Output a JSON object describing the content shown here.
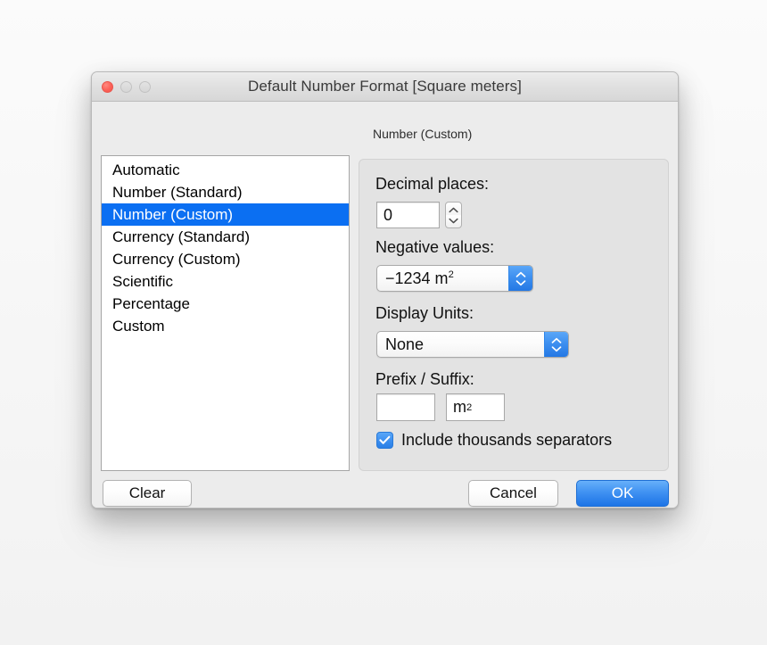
{
  "window": {
    "title": "Default Number Format [Square meters]",
    "traffic_lights": [
      {
        "name": "close",
        "color": "#fc6057"
      },
      {
        "name": "minimize",
        "color": "#d9d9d9"
      },
      {
        "name": "zoom",
        "color": "#d9d9d9"
      }
    ]
  },
  "format_list": {
    "items": [
      {
        "label": "Automatic",
        "selected": false
      },
      {
        "label": "Number (Standard)",
        "selected": false
      },
      {
        "label": "Number (Custom)",
        "selected": true
      },
      {
        "label": "Currency (Standard)",
        "selected": false
      },
      {
        "label": "Currency (Custom)",
        "selected": false
      },
      {
        "label": "Scientific",
        "selected": false
      },
      {
        "label": "Percentage",
        "selected": false
      },
      {
        "label": "Custom",
        "selected": false
      }
    ],
    "selection_color": "#0b6ff2"
  },
  "panel": {
    "caption": "Number (Custom)",
    "decimal_places": {
      "label": "Decimal places:",
      "value": "0"
    },
    "negative_values": {
      "label": "Negative values:",
      "value_prefix": "−1234 m",
      "value_exponent": "2"
    },
    "display_units": {
      "label": "Display Units:",
      "value": "None"
    },
    "prefix_suffix": {
      "label": "Prefix / Suffix:",
      "prefix_value": "",
      "suffix_prefix": "m",
      "suffix_exponent": "2"
    },
    "thousands": {
      "label": "Include thousands separators",
      "checked": true,
      "accent": "#3e90f0"
    }
  },
  "buttons": {
    "clear": "Clear",
    "cancel": "Cancel",
    "ok": "OK",
    "ok_accent": "#1d74e6"
  }
}
